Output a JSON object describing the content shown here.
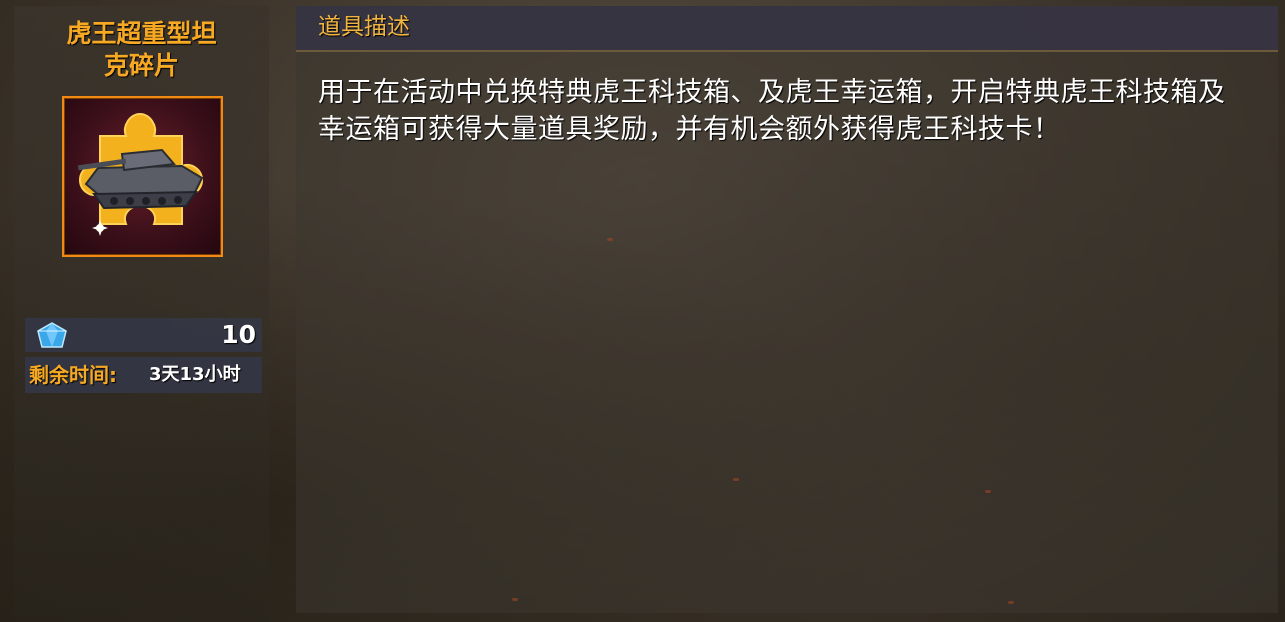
{
  "item": {
    "name": "虎王超重型坦\n克碎片",
    "icon": "tank-puzzle-piece-icon",
    "price_icon": "diamond-icon",
    "price": "10",
    "time_label": "剩余时间:",
    "time_value": "3天13小时"
  },
  "description": {
    "title": "道具描述",
    "text": "用于在活动中兑换特典虎王科技箱、及虎王幸运箱，开启特典虎王科技箱及幸运箱可获得大量道具奖励，并有机会额外获得虎王科技卡！"
  },
  "colors": {
    "name_gold": "#f7a923",
    "frame_orange": "#f08a12",
    "title_gold": "#f2b441"
  }
}
